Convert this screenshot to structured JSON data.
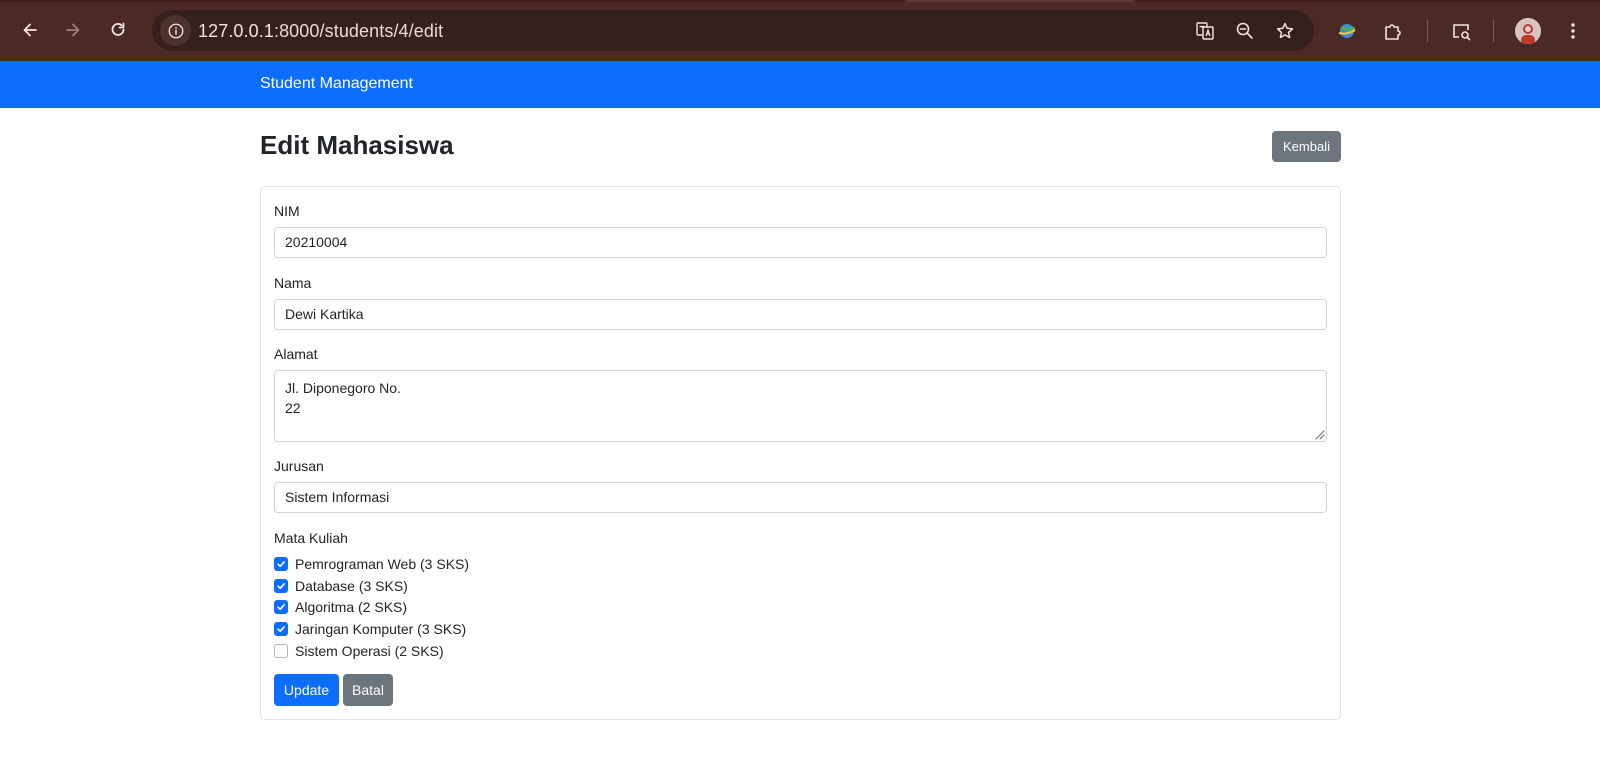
{
  "browser": {
    "url_host": "127.0.0.1",
    "url_port_path": ":8000/students/4/edit",
    "icons": [
      "back-icon",
      "forward-icon",
      "reload-icon",
      "info-icon",
      "translate-icon",
      "zoom-icon",
      "bookmark-star-icon",
      "extension-globe-icon",
      "extensions-puzzle-icon",
      "tab-search-icon",
      "profile-avatar",
      "kebab-menu-icon"
    ]
  },
  "navbar": {
    "brand": "Student Management"
  },
  "page": {
    "title": "Edit Mahasiswa",
    "back_button": "Kembali"
  },
  "form": {
    "nim_label": "NIM",
    "nim_value": "20210004",
    "nama_label": "Nama",
    "nama_value": "Dewi Kartika",
    "alamat_label": "Alamat",
    "alamat_value": "Jl. Diponegoro No.\n22",
    "jurusan_label": "Jurusan",
    "jurusan_value": "Sistem Informasi",
    "mata_kuliah_label": "Mata Kuliah",
    "courses": [
      {
        "label": "Pemrograman Web (3 SKS)",
        "checked": true
      },
      {
        "label": "Database (3 SKS)",
        "checked": true
      },
      {
        "label": "Algoritma (2 SKS)",
        "checked": true
      },
      {
        "label": "Jaringan Komputer (3 SKS)",
        "checked": true
      },
      {
        "label": "Sistem Operasi (2 SKS)",
        "checked": false
      }
    ],
    "update_button": "Update",
    "batal_button": "Batal"
  },
  "colors": {
    "primary": "#0d6efd",
    "secondary": "#6c757d",
    "chrome_bg": "#4b2a26"
  }
}
